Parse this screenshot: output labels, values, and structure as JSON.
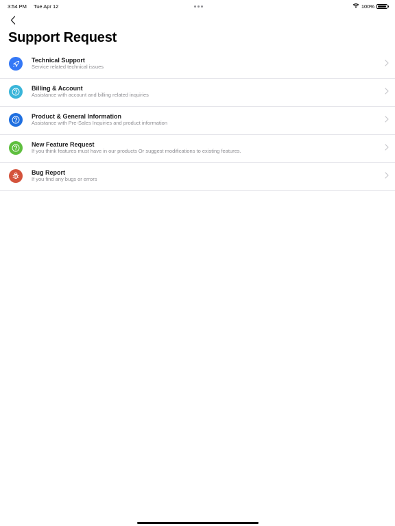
{
  "status_bar": {
    "time": "3:54 PM",
    "date": "Tue Apr 12",
    "battery_text": "100%",
    "battery_level": 1.0
  },
  "page": {
    "title": "Support Request"
  },
  "colors": {
    "technical": "#3478f6",
    "billing": "#39b5d9",
    "product": "#1f6fe0",
    "feature": "#5fbf3f",
    "bug": "#d4533c"
  },
  "items": [
    {
      "title": "Technical Support",
      "subtitle": "Service related technical issues",
      "icon": "rocket-icon",
      "color": "#3478f6"
    },
    {
      "title": "Billing & Account",
      "subtitle": "Assistance with account and billing related inquiries",
      "icon": "question-icon",
      "color": "#39b5d9"
    },
    {
      "title": "Product & General Information",
      "subtitle": "Assistance with Pre-Sales Inquiries and product information",
      "icon": "question-icon",
      "color": "#1f6fe0"
    },
    {
      "title": "New Feature Request",
      "subtitle": "If you think features must have in our products Or suggest modifications to existing features.",
      "icon": "question-icon",
      "color": "#5fbf3f"
    },
    {
      "title": "Bug Report",
      "subtitle": "If you find any bugs or errors",
      "icon": "bug-icon",
      "color": "#d4533c"
    }
  ]
}
